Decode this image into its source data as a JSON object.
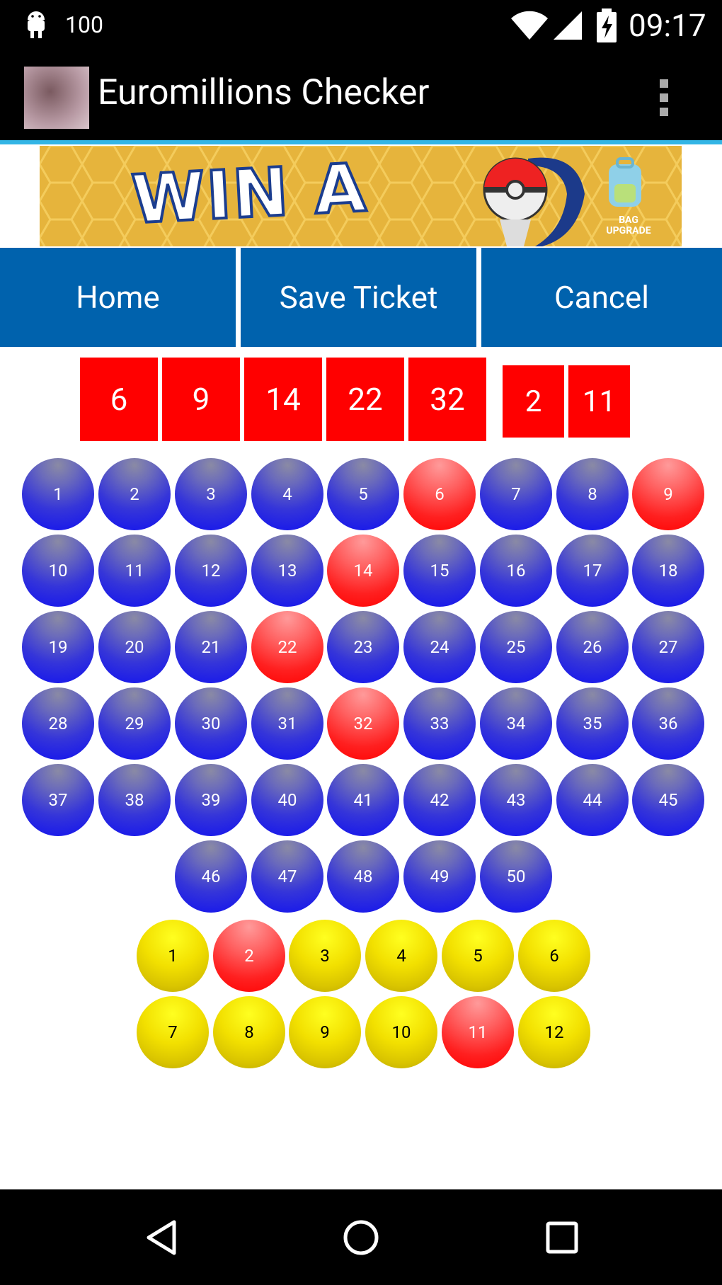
{
  "status_bar": {
    "notification_count": "100",
    "time": "09:17"
  },
  "app_bar": {
    "title": "Euromillions Checker"
  },
  "ad": {
    "headline": "WIN A",
    "badge_text": "BAG UPGRADE"
  },
  "nav": {
    "home": "Home",
    "save": "Save Ticket",
    "cancel": "Cancel"
  },
  "draw": {
    "main": [
      "6",
      "9",
      "14",
      "22",
      "32"
    ],
    "stars": [
      "2",
      "11"
    ]
  },
  "main_balls": [
    "1",
    "2",
    "3",
    "4",
    "5",
    "6",
    "7",
    "8",
    "9",
    "10",
    "11",
    "12",
    "13",
    "14",
    "15",
    "16",
    "17",
    "18",
    "19",
    "20",
    "21",
    "22",
    "23",
    "24",
    "25",
    "26",
    "27",
    "28",
    "29",
    "30",
    "31",
    "32",
    "33",
    "34",
    "35",
    "36",
    "37",
    "38",
    "39",
    "40",
    "41",
    "42",
    "43",
    "44",
    "45",
    "46",
    "47",
    "48",
    "49",
    "50"
  ],
  "selected_main": [
    6,
    9,
    14,
    22,
    32
  ],
  "star_balls": [
    "1",
    "2",
    "3",
    "4",
    "5",
    "6",
    "7",
    "8",
    "9",
    "10",
    "11",
    "12"
  ],
  "selected_stars": [
    2,
    11
  ],
  "colors": {
    "ball_blue": "#1010f0",
    "ball_red": "#ff0000",
    "ball_yellow": "#f2e000",
    "nav_blue": "#0062ad",
    "accent": "#33b5e5"
  }
}
